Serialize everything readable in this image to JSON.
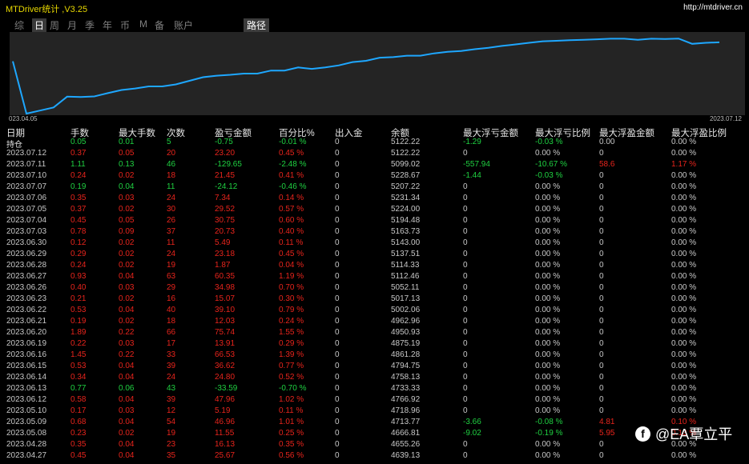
{
  "app": {
    "title": "MTDriver统计 ,V3.25",
    "url": "http://mtdriver.cn"
  },
  "period_tabs": [
    "综",
    "日",
    "周",
    "月",
    "季",
    "年",
    "币",
    "M",
    "备",
    "账户"
  ],
  "route_tab": "路径",
  "chart": {
    "start_label": "023.04.05",
    "end_label": "2023.07.12",
    "line_color": "#1ea7ff"
  },
  "chart_data": {
    "type": "line",
    "y_min": 4500,
    "y_max": 5280,
    "values": [
      5010,
      4500,
      4530,
      4560,
      4665,
      4662,
      4668,
      4700,
      4730,
      4745,
      4765,
      4765,
      4785,
      4820,
      4855,
      4870,
      4878,
      4890,
      4890,
      4920,
      4920,
      4950,
      4936,
      4950,
      4970,
      5002,
      5015,
      5045,
      5051,
      5065,
      5065,
      5087,
      5102,
      5111,
      5128,
      5141,
      5160,
      5175,
      5190,
      5205,
      5210,
      5215,
      5220,
      5225,
      5230,
      5230,
      5220,
      5230,
      5228,
      5232,
      5180,
      5190,
      5195
    ]
  },
  "table": {
    "headers": [
      "日期",
      "手数",
      "最大手数",
      "次数",
      "盈亏金额",
      "百分比%",
      "出入金",
      "余额",
      "最大浮亏金额",
      "最大浮亏比例",
      "最大浮盈金额",
      "最大浮盈比例"
    ],
    "rows": [
      {
        "date": "持仓",
        "lots": "0.05",
        "max_lots": "0.01",
        "count": "5",
        "pnl": "-0.75",
        "pct": "-0.01 %",
        "io": "0",
        "bal": "5122.22",
        "mfl_amt": "-1.29",
        "mfl_pct": "-0.03 %",
        "mfp_amt": "0.00",
        "mfp_pct": "0.00 %",
        "tone": "g"
      },
      {
        "date": "2023.07.12",
        "lots": "0.37",
        "max_lots": "0.05",
        "count": "20",
        "pnl": "23.20",
        "pct": "0.45 %",
        "io": "0",
        "bal": "5122.22",
        "mfl_amt": "0",
        "mfl_pct": "0.00 %",
        "mfp_amt": "0",
        "mfp_pct": "0.00 %",
        "tone": "r"
      },
      {
        "date": "2023.07.11",
        "lots": "1.11",
        "max_lots": "0.13",
        "count": "46",
        "pnl": "-129.65",
        "pct": "-2.48 %",
        "io": "0",
        "bal": "5099.02",
        "mfl_amt": "-557.94",
        "mfl_pct": "-10.67 %",
        "mfp_amt": "58.6",
        "mfp_pct": "1.17 %",
        "tone": "g"
      },
      {
        "date": "2023.07.10",
        "lots": "0.24",
        "max_lots": "0.02",
        "count": "18",
        "pnl": "21.45",
        "pct": "0.41 %",
        "io": "0",
        "bal": "5228.67",
        "mfl_amt": "-1.44",
        "mfl_pct": "-0.03 %",
        "mfp_amt": "0",
        "mfp_pct": "0.00 %",
        "tone": "r"
      },
      {
        "date": "2023.07.07",
        "lots": "0.19",
        "max_lots": "0.04",
        "count": "11",
        "pnl": "-24.12",
        "pct": "-0.46 %",
        "io": "0",
        "bal": "5207.22",
        "mfl_amt": "0",
        "mfl_pct": "0.00 %",
        "mfp_amt": "0",
        "mfp_pct": "0.00 %",
        "tone": "g"
      },
      {
        "date": "2023.07.06",
        "lots": "0.35",
        "max_lots": "0.03",
        "count": "24",
        "pnl": "7.34",
        "pct": "0.14 %",
        "io": "0",
        "bal": "5231.34",
        "mfl_amt": "0",
        "mfl_pct": "0.00 %",
        "mfp_amt": "0",
        "mfp_pct": "0.00 %",
        "tone": "r"
      },
      {
        "date": "2023.07.05",
        "lots": "0.37",
        "max_lots": "0.02",
        "count": "30",
        "pnl": "29.52",
        "pct": "0.57 %",
        "io": "0",
        "bal": "5224.00",
        "mfl_amt": "0",
        "mfl_pct": "0.00 %",
        "mfp_amt": "0",
        "mfp_pct": "0.00 %",
        "tone": "r"
      },
      {
        "date": "2023.07.04",
        "lots": "0.45",
        "max_lots": "0.05",
        "count": "26",
        "pnl": "30.75",
        "pct": "0.60 %",
        "io": "0",
        "bal": "5194.48",
        "mfl_amt": "0",
        "mfl_pct": "0.00 %",
        "mfp_amt": "0",
        "mfp_pct": "0.00 %",
        "tone": "r"
      },
      {
        "date": "2023.07.03",
        "lots": "0.78",
        "max_lots": "0.09",
        "count": "37",
        "pnl": "20.73",
        "pct": "0.40 %",
        "io": "0",
        "bal": "5163.73",
        "mfl_amt": "0",
        "mfl_pct": "0.00 %",
        "mfp_amt": "0",
        "mfp_pct": "0.00 %",
        "tone": "r"
      },
      {
        "date": "2023.06.30",
        "lots": "0.12",
        "max_lots": "0.02",
        "count": "11",
        "pnl": "5.49",
        "pct": "0.11 %",
        "io": "0",
        "bal": "5143.00",
        "mfl_amt": "0",
        "mfl_pct": "0.00 %",
        "mfp_amt": "0",
        "mfp_pct": "0.00 %",
        "tone": "r"
      },
      {
        "date": "2023.06.29",
        "lots": "0.29",
        "max_lots": "0.02",
        "count": "24",
        "pnl": "23.18",
        "pct": "0.45 %",
        "io": "0",
        "bal": "5137.51",
        "mfl_amt": "0",
        "mfl_pct": "0.00 %",
        "mfp_amt": "0",
        "mfp_pct": "0.00 %",
        "tone": "r"
      },
      {
        "date": "2023.06.28",
        "lots": "0.24",
        "max_lots": "0.02",
        "count": "19",
        "pnl": "1.87",
        "pct": "0.04 %",
        "io": "0",
        "bal": "5114.33",
        "mfl_amt": "0",
        "mfl_pct": "0.00 %",
        "mfp_amt": "0",
        "mfp_pct": "0.00 %",
        "tone": "r"
      },
      {
        "date": "2023.06.27",
        "lots": "0.93",
        "max_lots": "0.04",
        "count": "63",
        "pnl": "60.35",
        "pct": "1.19 %",
        "io": "0",
        "bal": "5112.46",
        "mfl_amt": "0",
        "mfl_pct": "0.00 %",
        "mfp_amt": "0",
        "mfp_pct": "0.00 %",
        "tone": "r"
      },
      {
        "date": "2023.06.26",
        "lots": "0.40",
        "max_lots": "0.03",
        "count": "29",
        "pnl": "34.98",
        "pct": "0.70 %",
        "io": "0",
        "bal": "5052.11",
        "mfl_amt": "0",
        "mfl_pct": "0.00 %",
        "mfp_amt": "0",
        "mfp_pct": "0.00 %",
        "tone": "r"
      },
      {
        "date": "2023.06.23",
        "lots": "0.21",
        "max_lots": "0.02",
        "count": "16",
        "pnl": "15.07",
        "pct": "0.30 %",
        "io": "0",
        "bal": "5017.13",
        "mfl_amt": "0",
        "mfl_pct": "0.00 %",
        "mfp_amt": "0",
        "mfp_pct": "0.00 %",
        "tone": "r"
      },
      {
        "date": "2023.06.22",
        "lots": "0.53",
        "max_lots": "0.04",
        "count": "40",
        "pnl": "39.10",
        "pct": "0.79 %",
        "io": "0",
        "bal": "5002.06",
        "mfl_amt": "0",
        "mfl_pct": "0.00 %",
        "mfp_amt": "0",
        "mfp_pct": "0.00 %",
        "tone": "r"
      },
      {
        "date": "2023.06.21",
        "lots": "0.19",
        "max_lots": "0.02",
        "count": "18",
        "pnl": "12.03",
        "pct": "0.24 %",
        "io": "0",
        "bal": "4962.96",
        "mfl_amt": "0",
        "mfl_pct": "0.00 %",
        "mfp_amt": "0",
        "mfp_pct": "0.00 %",
        "tone": "r"
      },
      {
        "date": "2023.06.20",
        "lots": "1.89",
        "max_lots": "0.22",
        "count": "66",
        "pnl": "75.74",
        "pct": "1.55 %",
        "io": "0",
        "bal": "4950.93",
        "mfl_amt": "0",
        "mfl_pct": "0.00 %",
        "mfp_amt": "0",
        "mfp_pct": "0.00 %",
        "tone": "r"
      },
      {
        "date": "2023.06.19",
        "lots": "0.22",
        "max_lots": "0.03",
        "count": "17",
        "pnl": "13.91",
        "pct": "0.29 %",
        "io": "0",
        "bal": "4875.19",
        "mfl_amt": "0",
        "mfl_pct": "0.00 %",
        "mfp_amt": "0",
        "mfp_pct": "0.00 %",
        "tone": "r"
      },
      {
        "date": "2023.06.16",
        "lots": "1.45",
        "max_lots": "0.22",
        "count": "33",
        "pnl": "66.53",
        "pct": "1.39 %",
        "io": "0",
        "bal": "4861.28",
        "mfl_amt": "0",
        "mfl_pct": "0.00 %",
        "mfp_amt": "0",
        "mfp_pct": "0.00 %",
        "tone": "r"
      },
      {
        "date": "2023.06.15",
        "lots": "0.53",
        "max_lots": "0.04",
        "count": "39",
        "pnl": "36.62",
        "pct": "0.77 %",
        "io": "0",
        "bal": "4794.75",
        "mfl_amt": "0",
        "mfl_pct": "0.00 %",
        "mfp_amt": "0",
        "mfp_pct": "0.00 %",
        "tone": "r"
      },
      {
        "date": "2023.06.14",
        "lots": "0.34",
        "max_lots": "0.04",
        "count": "24",
        "pnl": "24.80",
        "pct": "0.52 %",
        "io": "0",
        "bal": "4758.13",
        "mfl_amt": "0",
        "mfl_pct": "0.00 %",
        "mfp_amt": "0",
        "mfp_pct": "0.00 %",
        "tone": "r"
      },
      {
        "date": "2023.06.13",
        "lots": "0.77",
        "max_lots": "0.06",
        "count": "43",
        "pnl": "-33.59",
        "pct": "-0.70 %",
        "io": "0",
        "bal": "4733.33",
        "mfl_amt": "0",
        "mfl_pct": "0.00 %",
        "mfp_amt": "0",
        "mfp_pct": "0.00 %",
        "tone": "g"
      },
      {
        "date": "2023.06.12",
        "lots": "0.58",
        "max_lots": "0.04",
        "count": "39",
        "pnl": "47.96",
        "pct": "1.02 %",
        "io": "0",
        "bal": "4766.92",
        "mfl_amt": "0",
        "mfl_pct": "0.00 %",
        "mfp_amt": "0",
        "mfp_pct": "0.00 %",
        "tone": "r"
      },
      {
        "date": "2023.05.10",
        "lots": "0.17",
        "max_lots": "0.03",
        "count": "12",
        "pnl": "5.19",
        "pct": "0.11 %",
        "io": "0",
        "bal": "4718.96",
        "mfl_amt": "0",
        "mfl_pct": "0.00 %",
        "mfp_amt": "0",
        "mfp_pct": "0.00 %",
        "tone": "r"
      },
      {
        "date": "2023.05.09",
        "lots": "0.68",
        "max_lots": "0.04",
        "count": "54",
        "pnl": "46.96",
        "pct": "1.01 %",
        "io": "0",
        "bal": "4713.77",
        "mfl_amt": "-3.66",
        "mfl_pct": "-0.08 %",
        "mfp_amt": "4.81",
        "mfp_pct": "0.10 %",
        "tone": "r"
      },
      {
        "date": "2023.05.08",
        "lots": "0.23",
        "max_lots": "0.02",
        "count": "19",
        "pnl": "11.55",
        "pct": "0.25 %",
        "io": "0",
        "bal": "4666.81",
        "mfl_amt": "-9.02",
        "mfl_pct": "-0.19 %",
        "mfp_amt": "5.95",
        "mfp_pct": "0.13 %",
        "tone": "r"
      },
      {
        "date": "2023.04.28",
        "lots": "0.35",
        "max_lots": "0.04",
        "count": "23",
        "pnl": "16.13",
        "pct": "0.35 %",
        "io": "0",
        "bal": "4655.26",
        "mfl_amt": "0",
        "mfl_pct": "0.00 %",
        "mfp_amt": "0",
        "mfp_pct": "0.00 %",
        "tone": "r"
      },
      {
        "date": "2023.04.27",
        "lots": "0.45",
        "max_lots": "0.04",
        "count": "35",
        "pnl": "25.67",
        "pct": "0.56 %",
        "io": "0",
        "bal": "4639.13",
        "mfl_amt": "0",
        "mfl_pct": "0.00 %",
        "mfp_amt": "0",
        "mfp_pct": "0.00 %",
        "tone": "r"
      }
    ]
  },
  "watermark": {
    "icon": "facebook-icon",
    "text": "@EA覃立平"
  }
}
